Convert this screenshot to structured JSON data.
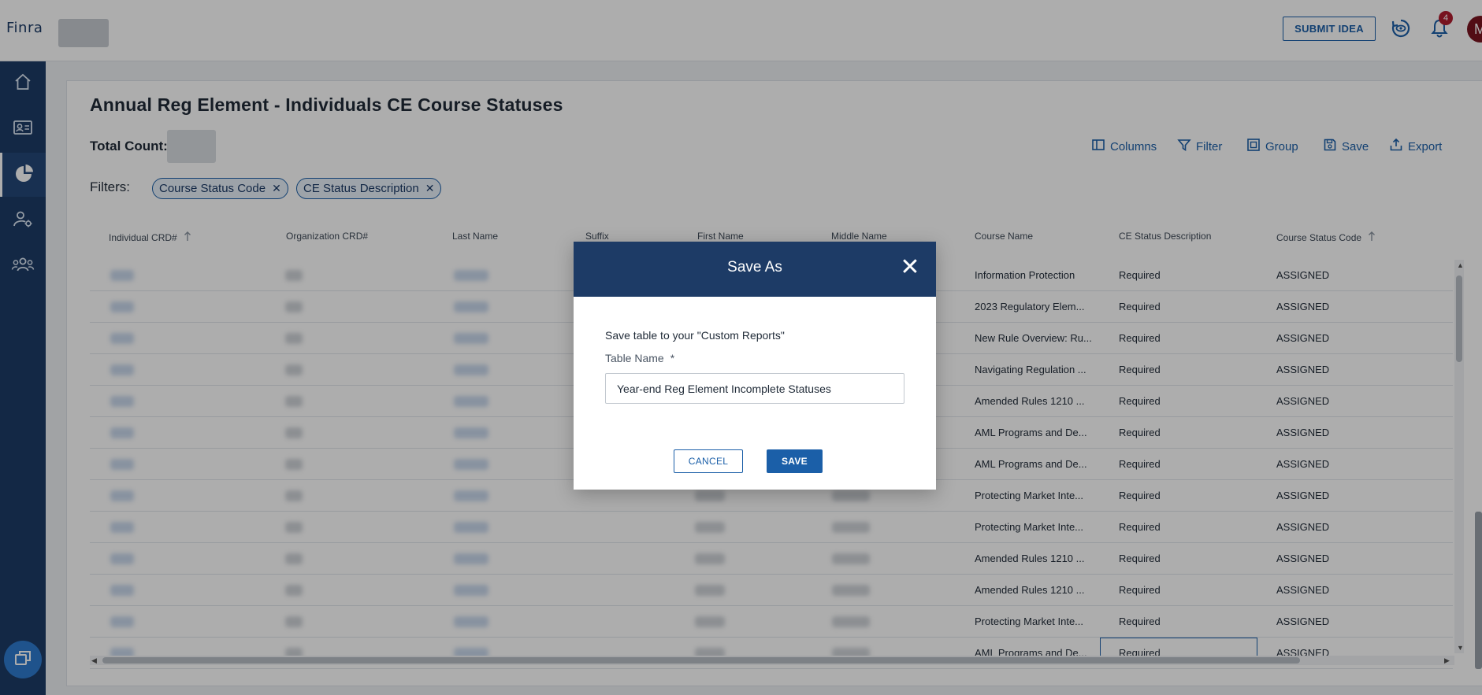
{
  "header": {
    "logo_text": "FINRA",
    "submit_idea_label": "SUBMIT IDEA",
    "notification_count": "4",
    "avatar_initial": "M"
  },
  "sidebar": {
    "items": [
      {
        "name": "home-icon"
      },
      {
        "name": "id-card-icon"
      },
      {
        "name": "pie-chart-icon",
        "active": true
      },
      {
        "name": "user-settings-icon"
      },
      {
        "name": "group-icon"
      }
    ],
    "bottom_button_icon": "windows-icon"
  },
  "page": {
    "title": "Annual Reg Element - Individuals CE Course Statuses",
    "total_count_label": "Total Count:",
    "filters_label": "Filters:",
    "filter_chips": [
      "Course Status Code",
      "CE Status Description"
    ],
    "toolbar": {
      "columns": "Columns",
      "filter": "Filter",
      "group": "Group",
      "save": "Save",
      "export": "Export"
    }
  },
  "table": {
    "columns": [
      "Individual CRD#",
      "Organization CRD#",
      "Last Name",
      "Suffix",
      "First Name",
      "Middle Name",
      "Course Name",
      "CE Status Description",
      "Course Status Code"
    ],
    "rows": [
      {
        "course_name": "Information Protection",
        "ce_status": "Required",
        "course_status": "ASSIGNED"
      },
      {
        "course_name": "2023 Regulatory Elem...",
        "ce_status": "Required",
        "course_status": "ASSIGNED"
      },
      {
        "course_name": "New Rule Overview: Ru...",
        "ce_status": "Required",
        "course_status": "ASSIGNED"
      },
      {
        "course_name": "Navigating Regulation ...",
        "ce_status": "Required",
        "course_status": "ASSIGNED"
      },
      {
        "course_name": "Amended Rules 1210 ...",
        "ce_status": "Required",
        "course_status": "ASSIGNED"
      },
      {
        "course_name": "AML Programs and De...",
        "ce_status": "Required",
        "course_status": "ASSIGNED"
      },
      {
        "course_name": "AML Programs and De...",
        "ce_status": "Required",
        "course_status": "ASSIGNED"
      },
      {
        "course_name": "Protecting Market Inte...",
        "ce_status": "Required",
        "course_status": "ASSIGNED"
      },
      {
        "course_name": "Protecting Market Inte...",
        "ce_status": "Required",
        "course_status": "ASSIGNED"
      },
      {
        "course_name": "Amended Rules 1210 ...",
        "ce_status": "Required",
        "course_status": "ASSIGNED"
      },
      {
        "course_name": "Amended Rules 1210 ...",
        "ce_status": "Required",
        "course_status": "ASSIGNED"
      },
      {
        "course_name": "Protecting Market Inte...",
        "ce_status": "Required",
        "course_status": "ASSIGNED"
      },
      {
        "course_name": "AML Programs and De...",
        "ce_status": "Required",
        "course_status": "ASSIGNED"
      }
    ]
  },
  "modal": {
    "title": "Save As",
    "description": "Save table to your \"Custom Reports\"",
    "field_label": "Table Name",
    "required_marker": "*",
    "field_value": "Year-end Reg Element Incomplete Statuses",
    "cancel_label": "CANCEL",
    "save_label": "SAVE"
  },
  "colors": {
    "brand_navy": "#1d3b66",
    "accent_blue": "#1b5fa8",
    "badge_red": "#b01c2e"
  }
}
